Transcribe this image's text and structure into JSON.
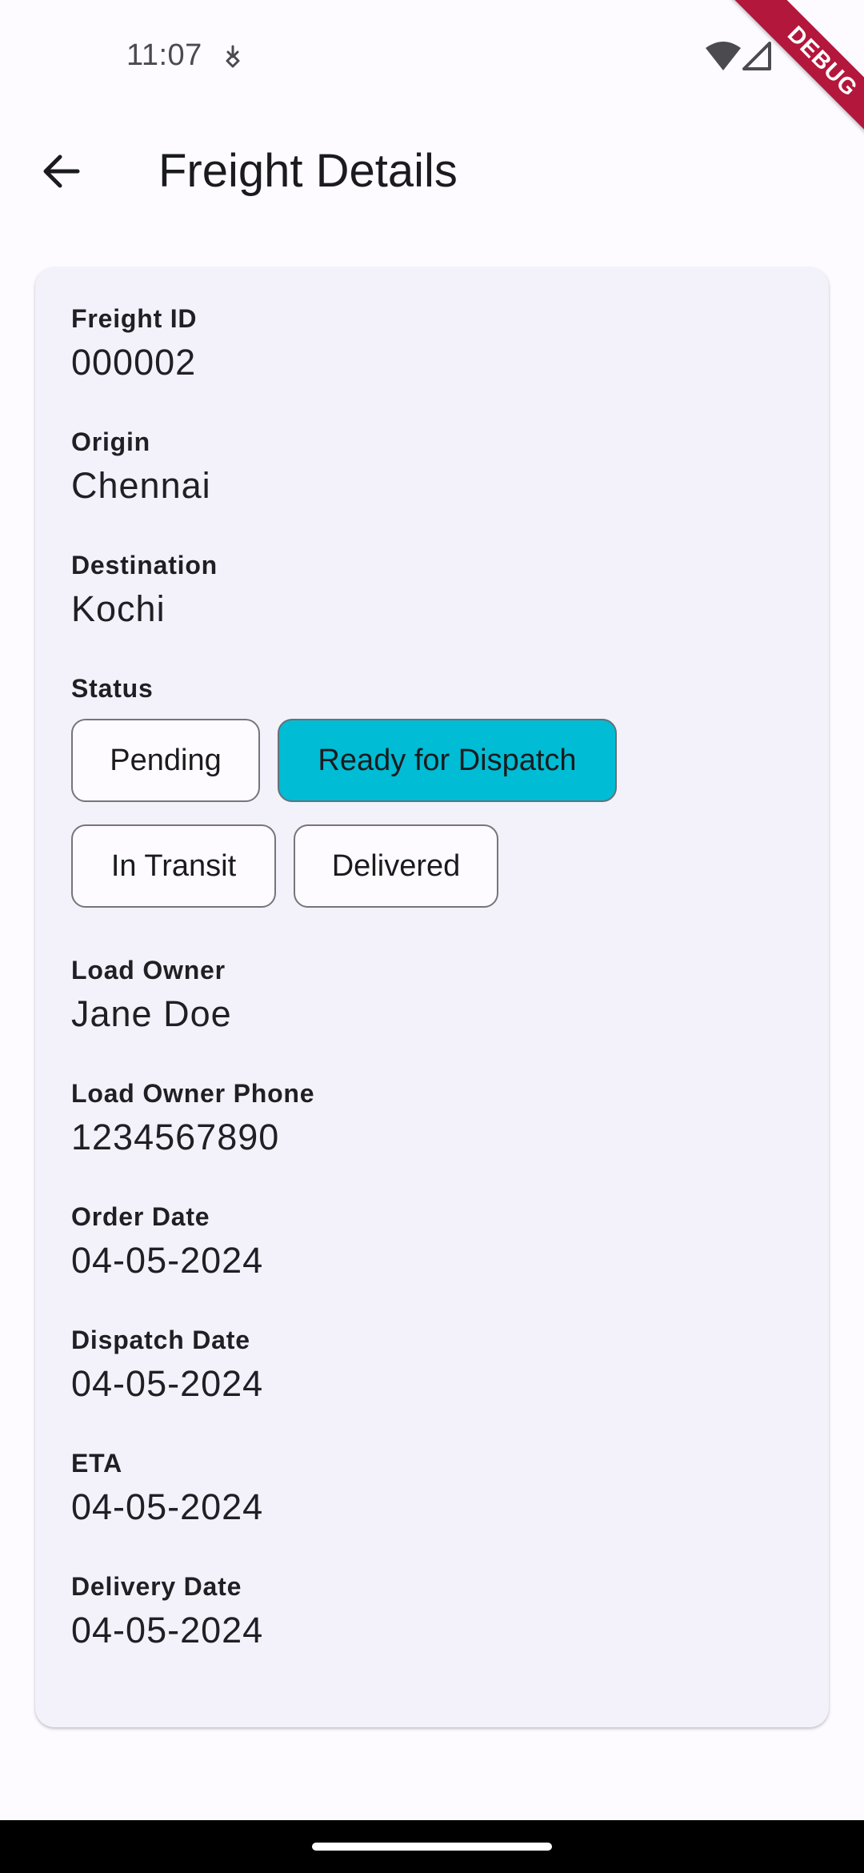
{
  "status_bar": {
    "time": "11:07",
    "notification_icon": "download-sync-icon",
    "wifi_icon": "wifi-icon",
    "signal_icon": "cell-signal-icon"
  },
  "debug_banner": {
    "label": "DEBUG",
    "color": "#b3173b"
  },
  "app_bar": {
    "back_icon": "arrow-back-icon",
    "title": "Freight Details"
  },
  "details": {
    "freight_id": {
      "label": "Freight ID",
      "value": "000002"
    },
    "origin": {
      "label": "Origin",
      "value": "Chennai"
    },
    "destination": {
      "label": "Destination",
      "value": "Kochi"
    },
    "status": {
      "label": "Status",
      "options": [
        "Pending",
        "Ready for Dispatch",
        "In Transit",
        "Delivered"
      ],
      "selected": "Ready for Dispatch",
      "selected_color": "#00bcd4"
    },
    "load_owner": {
      "label": "Load Owner",
      "value": "Jane Doe"
    },
    "load_owner_phone": {
      "label": "Load Owner Phone",
      "value": "1234567890"
    },
    "order_date": {
      "label": "Order Date",
      "value": "04-05-2024"
    },
    "dispatch_date": {
      "label": "Dispatch Date",
      "value": "04-05-2024"
    },
    "eta": {
      "label": "ETA",
      "value": "04-05-2024"
    },
    "delivery_date": {
      "label": "Delivery Date",
      "value": "04-05-2024"
    }
  },
  "colors": {
    "background": "#fdfbff",
    "card": "#f3f1fa",
    "nav_bar": "#000000"
  }
}
